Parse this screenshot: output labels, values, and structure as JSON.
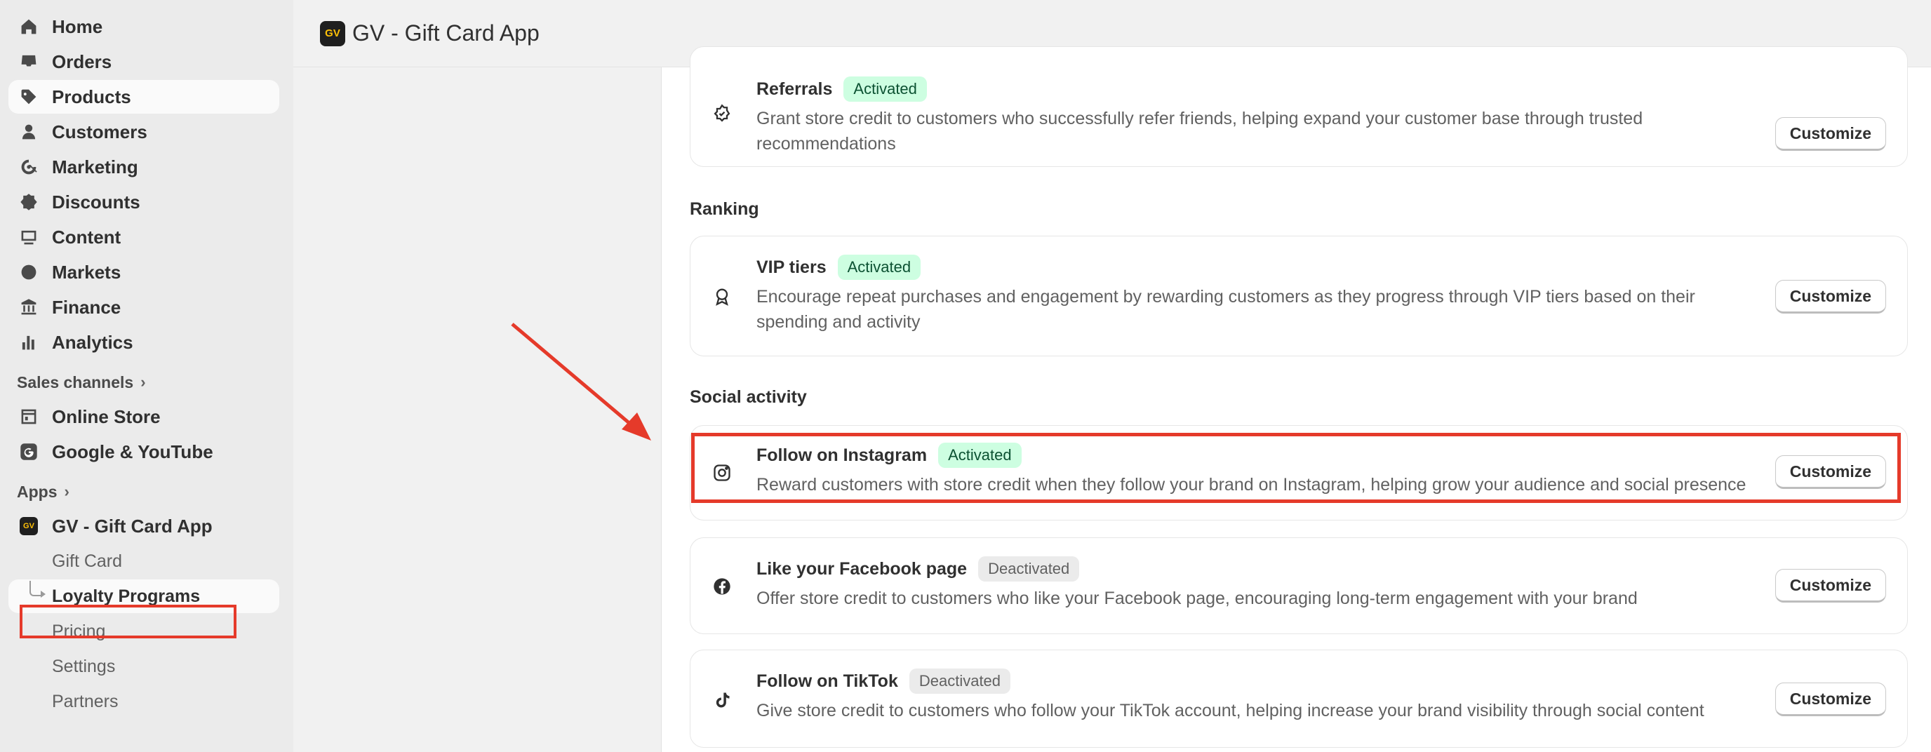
{
  "sidebar": {
    "nav": [
      {
        "label": "Home",
        "icon": "home-icon"
      },
      {
        "label": "Orders",
        "icon": "inbox-icon"
      },
      {
        "label": "Products",
        "icon": "tag-icon"
      },
      {
        "label": "Customers",
        "icon": "person-icon"
      },
      {
        "label": "Marketing",
        "icon": "target-icon"
      },
      {
        "label": "Discounts",
        "icon": "discount-icon"
      },
      {
        "label": "Content",
        "icon": "image-icon"
      },
      {
        "label": "Markets",
        "icon": "globe-icon"
      },
      {
        "label": "Finance",
        "icon": "bank-icon"
      },
      {
        "label": "Analytics",
        "icon": "chart-icon"
      }
    ],
    "sales_channels_label": "Sales channels",
    "sales_channels": [
      {
        "label": "Online Store",
        "icon": "store-icon"
      },
      {
        "label": "Google & YouTube",
        "icon": "google-icon"
      }
    ],
    "apps_label": "Apps",
    "app": {
      "label": "GV - Gift Card App",
      "logo": "GV"
    },
    "app_sub": [
      {
        "label": "Gift Card"
      },
      {
        "label": "Loyalty Programs"
      },
      {
        "label": "Pricing"
      },
      {
        "label": "Settings"
      },
      {
        "label": "Partners"
      }
    ]
  },
  "header": {
    "logo": "GV",
    "title": "GV - Gift Card App"
  },
  "content": {
    "referrals": {
      "title": "Referrals",
      "status": "Activated",
      "description": "Grant store credit to customers who successfully refer friends, helping expand your customer base through trusted recommendations",
      "button": "Customize"
    },
    "ranking_heading": "Ranking",
    "vip": {
      "title": "VIP tiers",
      "status": "Activated",
      "description": "Encourage repeat purchases and engagement by rewarding customers as they progress through VIP tiers based on their spending and activity",
      "button": "Customize"
    },
    "social_heading": "Social activity",
    "instagram": {
      "title": "Follow on Instagram",
      "status": "Activated",
      "description": "Reward customers with store credit when they follow your brand on Instagram, helping grow your audience and social presence",
      "button": "Customize"
    },
    "facebook": {
      "title": "Like your Facebook page",
      "status": "Deactivated",
      "description": "Offer store credit to customers who like your Facebook page, encouraging long-term engagement with your brand",
      "button": "Customize"
    },
    "tiktok": {
      "title": "Follow on TikTok",
      "status": "Deactivated",
      "description": "Give store credit to customers who follow your TikTok account, helping increase your brand visibility through social content",
      "button": "Customize"
    }
  },
  "colors": {
    "annotation": "#e53a2a",
    "activated_bg": "#cdfee1",
    "deactivated_bg": "#ebebeb"
  }
}
